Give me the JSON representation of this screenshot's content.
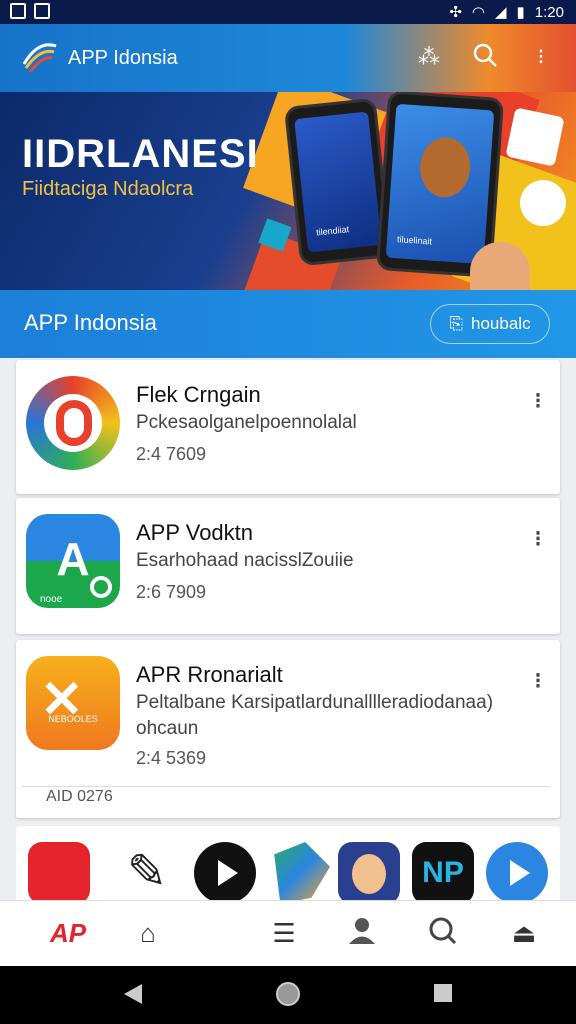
{
  "status_bar": {
    "time": "1:20"
  },
  "app_bar": {
    "title": "APP Idonsia"
  },
  "banner": {
    "headline": "IIDRLANESI",
    "subline": "Fiidtaciga Ndaolcra",
    "phone_caption_1": "tilendiiat",
    "phone_caption_2": "tiluelinait"
  },
  "section": {
    "title": "APP Indonsia",
    "button_label": "houbalc"
  },
  "apps": [
    {
      "name": "Flek Crngain",
      "desc": "Pckesaolganelpoennolalal",
      "meta": "2:4  7609"
    },
    {
      "name": "APP Vodktn",
      "desc": "Esarhohaad nacisslZouiie",
      "meta": "2:6  7909",
      "icon_label": "nooe"
    },
    {
      "name": "APR Rronarialt",
      "desc": "Peltalbane Karsipatlardunalllleradiodanaa) ohcaun",
      "meta": "2:4  5369",
      "icon_label": "NEBOOLES",
      "footer": "AID 0276"
    }
  ],
  "bottom_nav": {
    "brand": "AP"
  },
  "colors": {
    "primary": "#1c7fd8",
    "accent_orange": "#f08a2a",
    "accent_red": "#e2502f"
  }
}
